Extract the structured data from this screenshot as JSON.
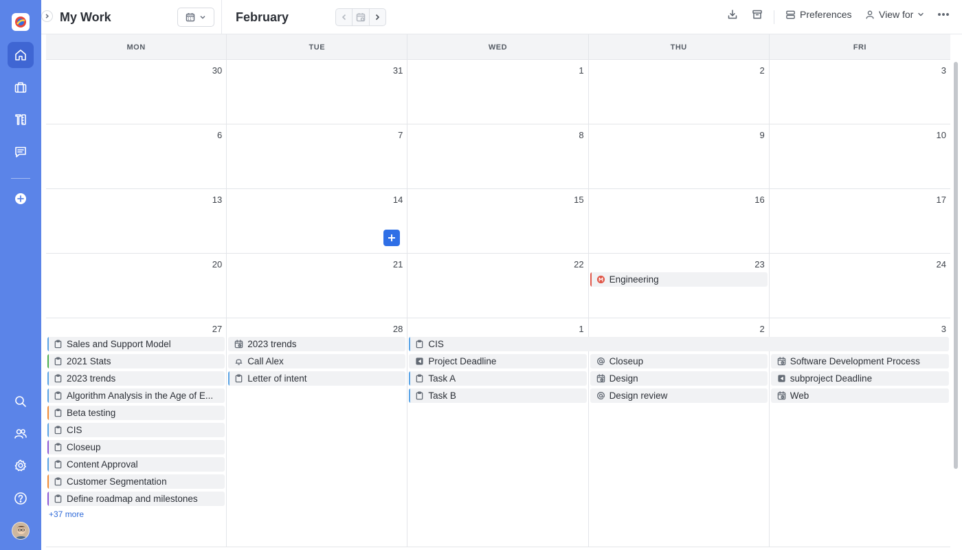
{
  "header": {
    "page_title": "My Work",
    "month": "February",
    "tools": {
      "preferences": "Preferences",
      "view_for": "View for"
    }
  },
  "weekdays": [
    "MON",
    "TUE",
    "WED",
    "THU",
    "FRI"
  ],
  "weeks": [
    {
      "days": [
        {
          "num": "30"
        },
        {
          "num": "31"
        },
        {
          "num": "1"
        },
        {
          "num": "2"
        },
        {
          "num": "3"
        }
      ]
    },
    {
      "days": [
        {
          "num": "6"
        },
        {
          "num": "7"
        },
        {
          "num": "8"
        },
        {
          "num": "9"
        },
        {
          "num": "10"
        }
      ]
    },
    {
      "days": [
        {
          "num": "13"
        },
        {
          "num": "14"
        },
        {
          "num": "15"
        },
        {
          "num": "16"
        },
        {
          "num": "17"
        }
      ]
    },
    {
      "days": [
        {
          "num": "20"
        },
        {
          "num": "21"
        },
        {
          "num": "22"
        },
        {
          "num": "23",
          "events": [
            {
              "label": "Engineering",
              "icon": "milestone-icon",
              "color": "#e0584a"
            }
          ]
        },
        {
          "num": "24"
        }
      ]
    },
    {
      "days": [
        {
          "num": "27",
          "more": "+37 more",
          "events": [
            {
              "label": "Sales and Support Model",
              "icon": "clipboard-icon",
              "color": "#5aa4e6"
            },
            {
              "label": "2021 Stats",
              "icon": "clipboard-icon",
              "color": "#4caf50"
            },
            {
              "label": "2023 trends",
              "icon": "clipboard-icon",
              "color": "#5aa4e6"
            },
            {
              "label": "Algorithm Analysis in the Age of E...",
              "icon": "clipboard-icon",
              "color": "#5aa4e6"
            },
            {
              "label": "Beta testing",
              "icon": "clipboard-icon",
              "color": "#f08c38"
            },
            {
              "label": "CIS",
              "icon": "clipboard-icon",
              "color": "#5aa4e6"
            },
            {
              "label": "Closeup",
              "icon": "clipboard-icon",
              "color": "#8e5bd6"
            },
            {
              "label": "Content Approval",
              "icon": "clipboard-icon",
              "color": "#5aa4e6"
            },
            {
              "label": "Customer Segmentation",
              "icon": "clipboard-icon",
              "color": "#f08c38"
            },
            {
              "label": "Define roadmap and milestones",
              "icon": "clipboard-icon",
              "color": "#8e5bd6"
            }
          ]
        },
        {
          "num": "28",
          "events": [
            {
              "label": "2023 trends",
              "icon": "calendar-clock-icon",
              "color": ""
            },
            {
              "label": "Call Alex",
              "icon": "bell-icon",
              "color": ""
            },
            {
              "label": "Letter of intent",
              "icon": "clipboard-icon",
              "color": "#5aa4e6"
            }
          ]
        },
        {
          "num": "1",
          "events": [
            {
              "label": "Project Deadline",
              "icon": "flag-icon",
              "color": ""
            },
            {
              "label": "Task A",
              "icon": "clipboard-icon",
              "color": "#5aa4e6"
            },
            {
              "label": "Task B",
              "icon": "clipboard-icon",
              "color": "#5aa4e6"
            }
          ]
        },
        {
          "num": "2",
          "events": [
            {
              "label": "Closeup",
              "icon": "at-icon",
              "color": ""
            },
            {
              "label": "Design",
              "icon": "calendar-clock-icon",
              "color": ""
            },
            {
              "label": "Design review",
              "icon": "at-icon",
              "color": ""
            }
          ]
        },
        {
          "num": "3",
          "events": [
            {
              "label": "Software Development Process",
              "icon": "calendar-clock-icon",
              "color": ""
            },
            {
              "label": "subproject Deadline",
              "icon": "flag-icon",
              "color": ""
            },
            {
              "label": "Web",
              "icon": "calendar-clock-icon",
              "color": ""
            }
          ]
        }
      ]
    }
  ],
  "spanning_event": {
    "label": "CIS",
    "icon": "clipboard-icon",
    "color": "#5aa4e6"
  },
  "colors": {
    "rail": "#5b84e8",
    "rail_active": "#3f66d3",
    "accent": "#2f6fe6"
  }
}
